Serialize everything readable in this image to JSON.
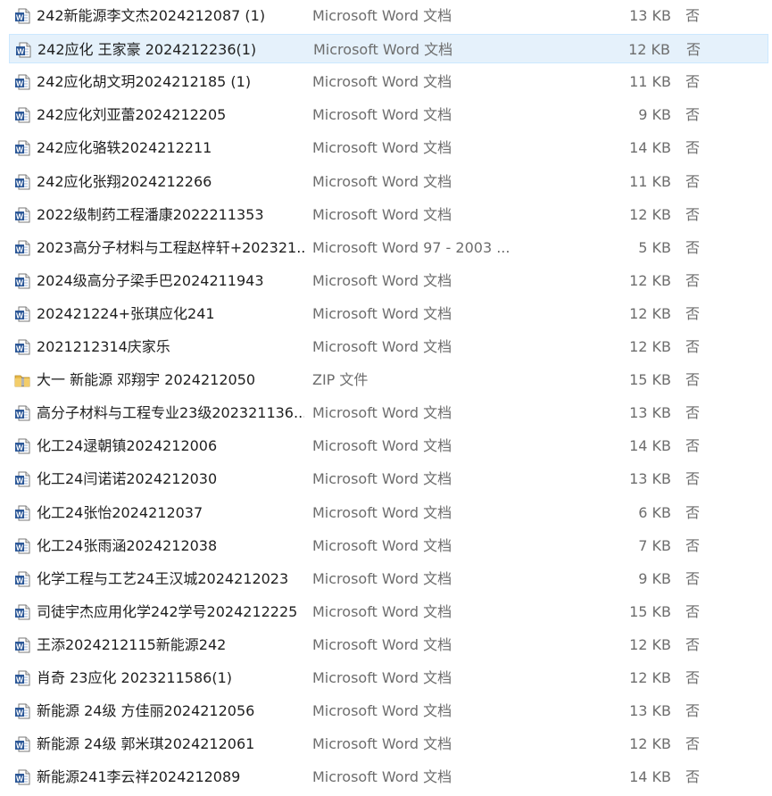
{
  "files": [
    {
      "name": "242新能源李文杰2024212087 (1)",
      "type": "Microsoft Word 文档",
      "size": "13 KB",
      "flag": "否",
      "icon": "word-icon"
    },
    {
      "name": "242应化  王家豪  2024212236(1)",
      "type": "Microsoft Word 文档",
      "size": "12 KB",
      "flag": "否",
      "icon": "word-icon",
      "selected": true
    },
    {
      "name": "242应化胡文玥2024212185 (1)",
      "type": "Microsoft Word 文档",
      "size": "11 KB",
      "flag": "否",
      "icon": "word-icon"
    },
    {
      "name": "242应化刘亚蕾2024212205",
      "type": "Microsoft Word 文档",
      "size": "9 KB",
      "flag": "否",
      "icon": "word-icon"
    },
    {
      "name": "242应化骆轶2024212211",
      "type": "Microsoft Word 文档",
      "size": "14 KB",
      "flag": "否",
      "icon": "word-icon"
    },
    {
      "name": "242应化张翔2024212266",
      "type": "Microsoft Word 文档",
      "size": "11 KB",
      "flag": "否",
      "icon": "word-icon"
    },
    {
      "name": "2022级制药工程潘康2022211353",
      "type": "Microsoft Word 文档",
      "size": "12 KB",
      "flag": "否",
      "icon": "word-icon"
    },
    {
      "name": "2023高分子材料与工程赵梓轩+202321...",
      "type": "Microsoft Word 97 - 2003 ...",
      "size": "5 KB",
      "flag": "否",
      "icon": "word-icon"
    },
    {
      "name": "2024级高分子梁手巴2024211943",
      "type": "Microsoft Word 文档",
      "size": "12 KB",
      "flag": "否",
      "icon": "word-icon"
    },
    {
      "name": "202421224+张琪应化241",
      "type": "Microsoft Word 文档",
      "size": "12 KB",
      "flag": "否",
      "icon": "word-icon"
    },
    {
      "name": "2021212314庆家乐",
      "type": "Microsoft Word 文档",
      "size": "12 KB",
      "flag": "否",
      "icon": "word-icon"
    },
    {
      "name": "大一 新能源 邓翔宇 2024212050",
      "type": "ZIP 文件",
      "size": "15 KB",
      "flag": "否",
      "icon": "zip-folder-icon"
    },
    {
      "name": "高分子材料与工程专业23级202321136...",
      "type": "Microsoft Word 文档",
      "size": "13 KB",
      "flag": "否",
      "icon": "word-icon"
    },
    {
      "name": "化工24逯朝镇2024212006",
      "type": "Microsoft Word 文档",
      "size": "14 KB",
      "flag": "否",
      "icon": "word-icon"
    },
    {
      "name": "化工24闫诺诺2024212030",
      "type": "Microsoft Word 文档",
      "size": "13 KB",
      "flag": "否",
      "icon": "word-icon"
    },
    {
      "name": "化工24张怡2024212037",
      "type": "Microsoft Word 文档",
      "size": "6 KB",
      "flag": "否",
      "icon": "word-icon"
    },
    {
      "name": "化工24张雨涵2024212038",
      "type": "Microsoft Word 文档",
      "size": "7 KB",
      "flag": "否",
      "icon": "word-icon"
    },
    {
      "name": "化学工程与工艺24王汉城2024212023",
      "type": "Microsoft Word 文档",
      "size": "9 KB",
      "flag": "否",
      "icon": "word-icon"
    },
    {
      "name": "司徒宇杰应用化学242学号2024212225",
      "type": "Microsoft Word 文档",
      "size": "15 KB",
      "flag": "否",
      "icon": "word-icon"
    },
    {
      "name": "王添2024212115新能源242",
      "type": "Microsoft Word 文档",
      "size": "12 KB",
      "flag": "否",
      "icon": "word-icon"
    },
    {
      "name": "肖奇 23应化 2023211586(1)",
      "type": "Microsoft Word 文档",
      "size": "12 KB",
      "flag": "否",
      "icon": "word-icon"
    },
    {
      "name": "新能源 24级 方佳丽2024212056",
      "type": "Microsoft Word 文档",
      "size": "13 KB",
      "flag": "否",
      "icon": "word-icon"
    },
    {
      "name": "新能源 24级 郭米琪2024212061",
      "type": "Microsoft Word 文档",
      "size": "12 KB",
      "flag": "否",
      "icon": "word-icon"
    },
    {
      "name": "新能源241李云祥2024212089",
      "type": "Microsoft Word 文档",
      "size": "14 KB",
      "flag": "否",
      "icon": "word-icon"
    }
  ],
  "colors": {
    "selected_bg": "#e5f1fb",
    "selected_border": "#cce8ff",
    "word_blue": "#2b5797",
    "zip_yellow": "#e8b94a"
  }
}
